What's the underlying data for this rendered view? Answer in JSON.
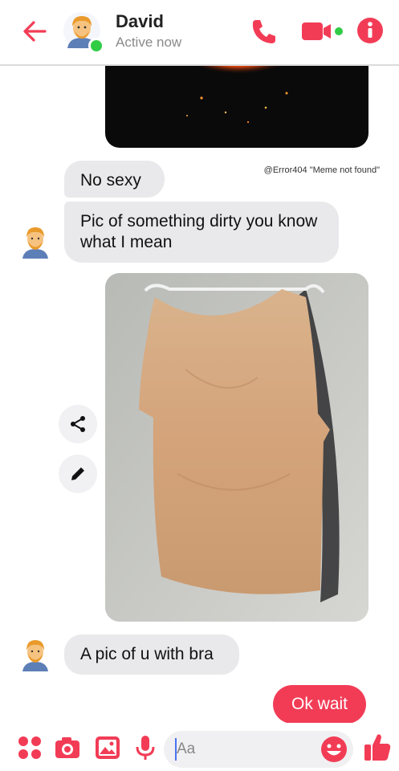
{
  "header": {
    "contact_name": "David",
    "status": "Active now",
    "icons": [
      "back-arrow-icon",
      "avatar",
      "phone-icon",
      "video-camera-icon",
      "info-icon"
    ]
  },
  "colors": {
    "accent": "#f23c56",
    "online": "#31cc46",
    "incoming_bubble": "#e9e9eb"
  },
  "messages": [
    {
      "side": "in",
      "text": "No sexy"
    },
    {
      "side": "in",
      "text": "Pic of something dirty you know what I mean"
    },
    {
      "side": "in",
      "text": "A pic of u with bra"
    },
    {
      "side": "out",
      "text": "Ok wait"
    }
  ],
  "image_watermark": "@Error404 \"Meme not found\"",
  "composer": {
    "placeholder": "Aa",
    "icons": [
      "apps-icon",
      "camera-icon",
      "gallery-icon",
      "microphone-icon",
      "emoji-icon",
      "thumbs-up-icon"
    ]
  }
}
